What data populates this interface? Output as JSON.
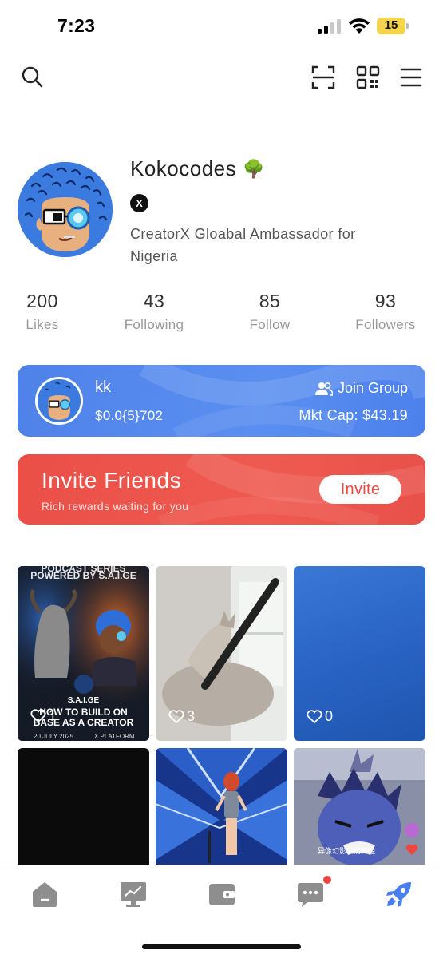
{
  "status_bar": {
    "time": "7:23",
    "battery": "15"
  },
  "top_nav": {
    "icons": [
      "search-icon",
      "scan-icon",
      "qr-code-icon",
      "menu-icon"
    ]
  },
  "profile": {
    "name": "Kokocodes",
    "name_emoji": "🌳",
    "social_badge": "X",
    "bio": "CreatorX Gloabal Ambassador for Nigeria"
  },
  "stats": [
    {
      "value": "200",
      "label": "Likes"
    },
    {
      "value": "43",
      "label": "Following"
    },
    {
      "value": "85",
      "label": "Follow"
    },
    {
      "value": "93",
      "label": "Followers"
    }
  ],
  "token_card": {
    "name": "kk",
    "price": "$0.0{5}702",
    "join_label": "Join Group",
    "mkt_cap": "Mkt Cap: $43.19",
    "color": "#5287ee"
  },
  "invite_card": {
    "title": "Invite Friends",
    "subtitle": "Rich rewards waiting for you",
    "button": "Invite",
    "color": "#ec524b"
  },
  "posts": [
    {
      "likes": "1",
      "caption_top_1": "PODCAST SERIES",
      "caption_top_2": "POWERED BY S.A.I.GE",
      "caption_mid": "S.A.I.GE",
      "caption_main_1": "HOW TO BUILD ON",
      "caption_main_2": "BASE AS A CREATOR",
      "caption_date": "20 JULY 2025",
      "caption_platform": "X PLATFORM"
    },
    {
      "likes": "3"
    },
    {
      "likes": "0"
    },
    {},
    {},
    {
      "overlay_text": "异像幻影表情神经"
    }
  ],
  "tab_bar": {
    "tabs": [
      "home-icon",
      "chart-icon",
      "wallet-icon",
      "chat-icon",
      "rocket-icon"
    ],
    "active": "rocket-icon",
    "accent": "#4a7ff0",
    "inactive": "#8e8e8e",
    "badge_color": "#e9473f"
  }
}
